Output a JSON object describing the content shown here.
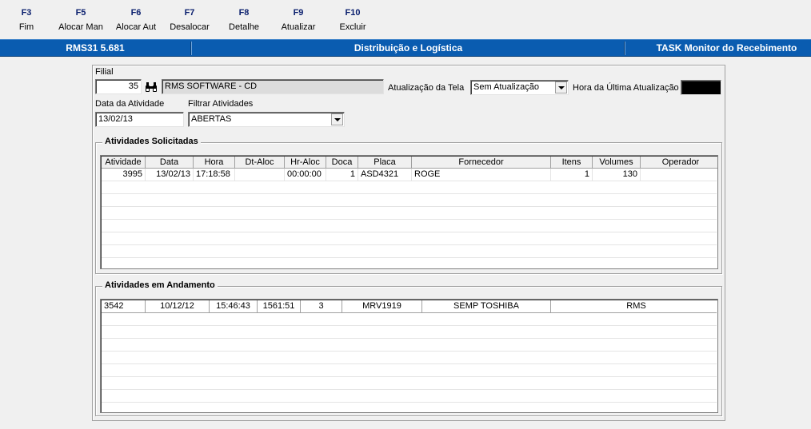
{
  "toolbar": [
    {
      "key": "F3",
      "label": "Fim"
    },
    {
      "key": "F5",
      "label": "Alocar Man"
    },
    {
      "key": "F6",
      "label": "Alocar Aut"
    },
    {
      "key": "F7",
      "label": "Desalocar"
    },
    {
      "key": "F8",
      "label": "Detalhe"
    },
    {
      "key": "F9",
      "label": "Atualizar"
    },
    {
      "key": "F10",
      "label": "Excluir"
    }
  ],
  "titlebar": {
    "app": "RMS31 5.681",
    "module": "Distribuição e Logística",
    "task": "TASK Monitor do Recebimento"
  },
  "form": {
    "filial_label": "Filial",
    "filial_value": "35",
    "filial_name": "RMS SOFTWARE - CD",
    "atualizacao_label": "Atualização da Tela",
    "atualizacao_value": "Sem Atualização",
    "hora_label": "Hora da Última Atualização",
    "data_label": "Data da Atividade",
    "data_value": "13/02/13",
    "filtrar_label": "Filtrar Atividades",
    "filtrar_value": "ABERTAS"
  },
  "solicitadas": {
    "title": "Atividades Solicitadas",
    "columns": [
      "Atividade",
      "Data",
      "Hora",
      "Dt-Aloc",
      "Hr-Aloc",
      "Doca",
      "Placa",
      "Fornecedor",
      "Itens",
      "Volumes",
      "Operador"
    ],
    "rows": [
      [
        "3995",
        "13/02/13",
        "17:18:58",
        "",
        "00:00:00",
        "1",
        "ASD4321",
        "ROGE",
        "1",
        "130",
        ""
      ]
    ]
  },
  "andamento": {
    "title": "Atividades em Andamento",
    "rows": [
      [
        "3542",
        "10/12/12",
        "15:46:43",
        "1561:51",
        "3",
        "MRV1919",
        "SEMP TOSHIBA",
        "RMS"
      ]
    ]
  },
  "colors": {
    "titlebar_bg": "#0a5cb0",
    "fkey_text": "#0a1f6e"
  },
  "icons": {
    "lookup": "binoculars-icon",
    "dropdown": "chevron-down-icon"
  }
}
